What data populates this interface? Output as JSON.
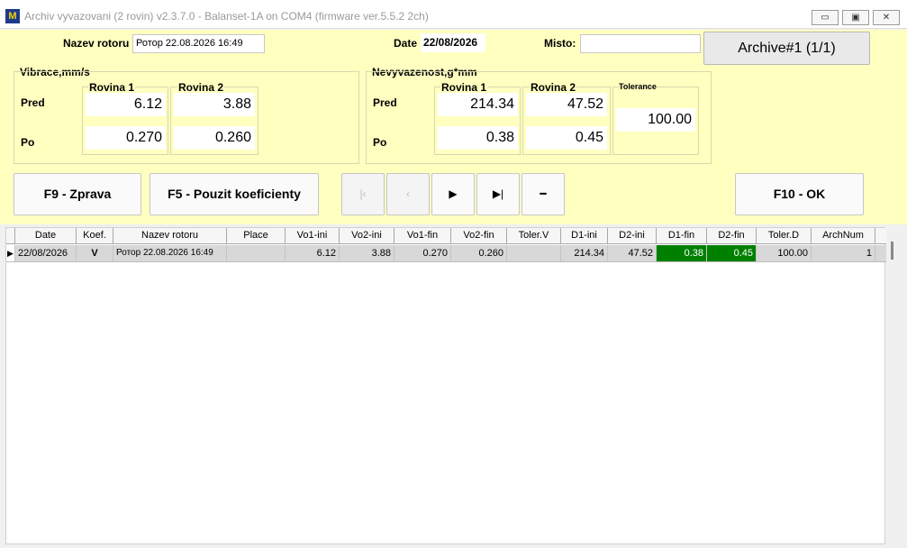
{
  "window": {
    "title": "Archiv vyvazovani (2 rovin) v2.3.7.0 - Balanset-1A on COM4 (firmware ver.5.5.2 2ch)",
    "icon_text": "M",
    "minimize": "▭",
    "maximize": "▣",
    "close": "✕"
  },
  "header": {
    "rotor_label": "Nazev rotoru",
    "rotor_value": "Ротор 22.08.2026 16:49",
    "date_label": "Date",
    "date_value": "22/08/2026",
    "place_label": "Misto:",
    "place_value": "",
    "archive_button": "Archive#1 (1/1)"
  },
  "vibration": {
    "group_label": "Vibrace,mm/s",
    "col1": "Rovina 1",
    "col2": "Rovina 2",
    "row_pred": "Pred",
    "row_po": "Po",
    "pred1": "6.12",
    "pred2": "3.88",
    "po1": "0.270",
    "po2": "0.260"
  },
  "unbalance": {
    "group_label": "Nevyvazenost,g*mm",
    "col1": "Rovina 1",
    "col2": "Rovina 2",
    "tol_label": "Tolerance",
    "row_pred": "Pred",
    "row_po": "Po",
    "pred1": "214.34",
    "pred2": "47.52",
    "po1": "0.38",
    "po2": "0.45",
    "tolerance": "100.00"
  },
  "buttons": {
    "f9": "F9 - Zprava",
    "f5": "F5 - Pouzit koeficienty",
    "f10": "F10 - OK",
    "nav_first": "|‹",
    "nav_prev": "‹",
    "nav_next": "▶",
    "nav_last": "▶|",
    "nav_delete": "━"
  },
  "table": {
    "columns": [
      "Date",
      "Koef.",
      "Nazev rotoru",
      "Place",
      "Vo1-ini",
      "Vo2-ini",
      "Vo1-fin",
      "Vo2-fin",
      "Toler.V",
      "D1-ini",
      "D2-ini",
      "D1-fin",
      "D2-fin",
      "Toler.D",
      "ArchNum"
    ],
    "row": {
      "indicator": "▶",
      "date": "22/08/2026",
      "koef": "V",
      "rotor": "Ротор 22.08.2026 16:49",
      "place": "",
      "vo1_ini": "6.12",
      "vo2_ini": "3.88",
      "vo1_fin": "0.270",
      "vo2_fin": "0.260",
      "toler_v": "",
      "d1_ini": "214.34",
      "d2_ini": "47.52",
      "d1_fin": "0.38",
      "d2_fin": "0.45",
      "toler_d": "100.00",
      "archnum": "1"
    }
  },
  "colors": {
    "panel_bg": "#ffffc0",
    "highlight_green": "#008000"
  }
}
